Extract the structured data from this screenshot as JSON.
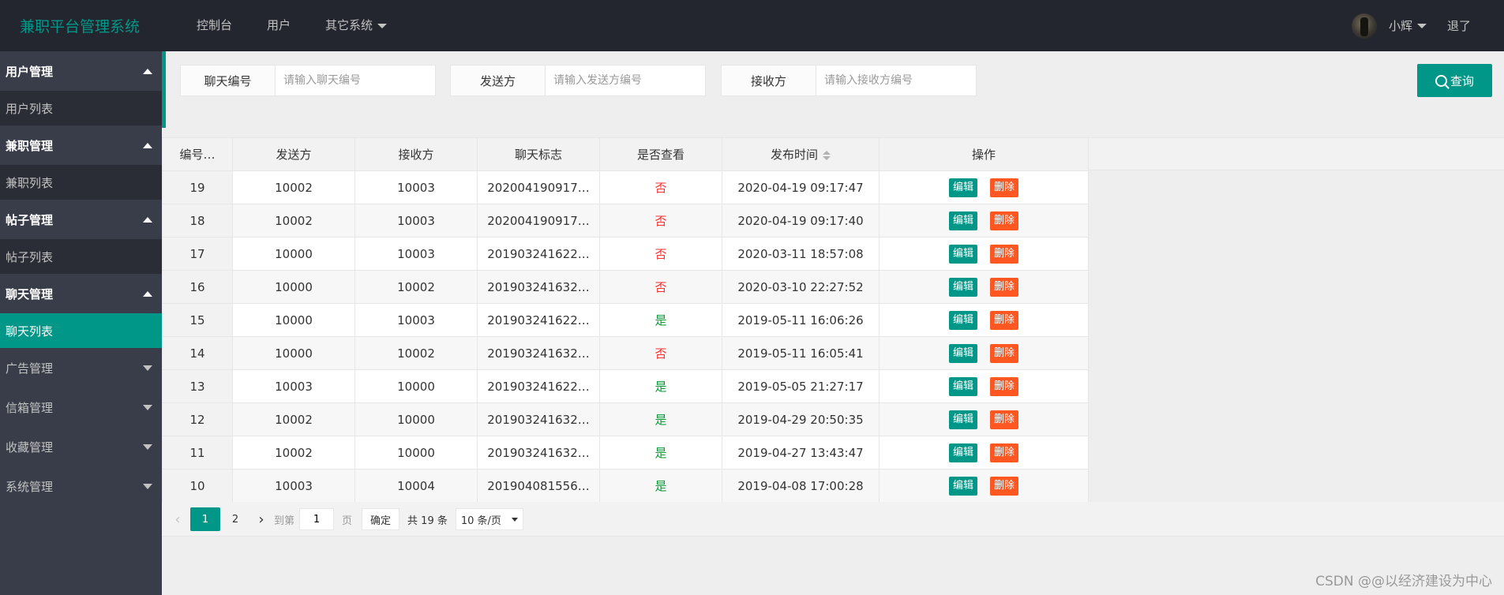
{
  "app": {
    "title": "兼职平台管理系统"
  },
  "topnav": [
    {
      "label": "控制台"
    },
    {
      "label": "用户"
    },
    {
      "label": "其它系统"
    }
  ],
  "user": {
    "name": "小辉",
    "logout": "退了"
  },
  "sidebar": {
    "groups": [
      {
        "label": "用户管理",
        "open": true,
        "children": [
          "用户列表"
        ]
      },
      {
        "label": "兼职管理",
        "open": true,
        "children": [
          "兼职列表"
        ]
      },
      {
        "label": "帖子管理",
        "open": true,
        "children": [
          "帖子列表"
        ]
      },
      {
        "label": "聊天管理",
        "open": true,
        "children": [
          "聊天列表"
        ]
      },
      {
        "label": "广告管理",
        "open": false
      },
      {
        "label": "信箱管理",
        "open": false
      },
      {
        "label": "收藏管理",
        "open": false
      },
      {
        "label": "系统管理",
        "open": false
      }
    ],
    "active_child": "聊天列表"
  },
  "search": {
    "chat_id": {
      "label": "聊天编号",
      "placeholder": "请输入聊天编号",
      "value": ""
    },
    "sender": {
      "label": "发送方",
      "placeholder": "请输入发送方编号",
      "value": ""
    },
    "receiver": {
      "label": "接收方",
      "placeholder": "请输入接收方编号",
      "value": ""
    },
    "query_label": "查询"
  },
  "table": {
    "columns": [
      "编号…",
      "发送方",
      "接收方",
      "聊天标志",
      "是否查看",
      "发布时间",
      "操作"
    ],
    "edit_label": "编辑",
    "delete_label": "删除",
    "rows": [
      {
        "id": "19",
        "sender": "10002",
        "receiver": "10003",
        "flag": "202004190917…",
        "viewed": "否",
        "time": "2020-04-19 09:17:47"
      },
      {
        "id": "18",
        "sender": "10002",
        "receiver": "10003",
        "flag": "202004190917…",
        "viewed": "否",
        "time": "2020-04-19 09:17:40"
      },
      {
        "id": "17",
        "sender": "10000",
        "receiver": "10003",
        "flag": "201903241622…",
        "viewed": "否",
        "time": "2020-03-11 18:57:08"
      },
      {
        "id": "16",
        "sender": "10000",
        "receiver": "10002",
        "flag": "201903241632…",
        "viewed": "否",
        "time": "2020-03-10 22:27:52"
      },
      {
        "id": "15",
        "sender": "10000",
        "receiver": "10003",
        "flag": "201903241622…",
        "viewed": "是",
        "time": "2019-05-11 16:06:26"
      },
      {
        "id": "14",
        "sender": "10000",
        "receiver": "10002",
        "flag": "201903241632…",
        "viewed": "否",
        "time": "2019-05-11 16:05:41"
      },
      {
        "id": "13",
        "sender": "10003",
        "receiver": "10000",
        "flag": "201903241622…",
        "viewed": "是",
        "time": "2019-05-05 21:27:17"
      },
      {
        "id": "12",
        "sender": "10002",
        "receiver": "10000",
        "flag": "201903241632…",
        "viewed": "是",
        "time": "2019-04-29 20:50:35"
      },
      {
        "id": "11",
        "sender": "10002",
        "receiver": "10000",
        "flag": "201903241632…",
        "viewed": "是",
        "time": "2019-04-27 13:43:47"
      },
      {
        "id": "10",
        "sender": "10003",
        "receiver": "10004",
        "flag": "201904081556…",
        "viewed": "是",
        "time": "2019-04-08 17:00:28"
      }
    ]
  },
  "pagination": {
    "pages": [
      "1",
      "2"
    ],
    "current": "1",
    "goto_label": "到第",
    "goto_value": "1",
    "page_suffix": "页",
    "confirm_label": "确定",
    "total_text": "共 19 条",
    "page_size": "10 条/页"
  },
  "watermark": "CSDN @@以经济建设为中心",
  "colors": {
    "accent": "#009688",
    "danger": "#ff5722",
    "header_bg": "#23262e",
    "sidebar_bg": "#393d49",
    "no": "#ff2e2e",
    "yes": "#0a9a3a"
  }
}
